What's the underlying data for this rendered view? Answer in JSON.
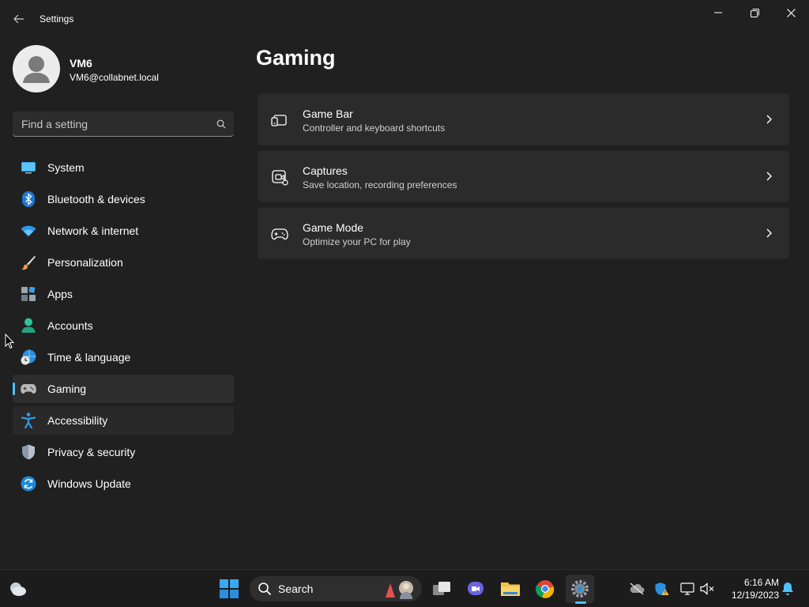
{
  "window": {
    "title": "Settings"
  },
  "profile": {
    "name": "VM6",
    "email": "VM6@collabnet.local"
  },
  "search": {
    "placeholder": "Find a setting"
  },
  "sidebar": {
    "items": [
      {
        "label": "System",
        "icon": "system-icon"
      },
      {
        "label": "Bluetooth & devices",
        "icon": "bluetooth-icon"
      },
      {
        "label": "Network & internet",
        "icon": "wifi-icon"
      },
      {
        "label": "Personalization",
        "icon": "brush-icon"
      },
      {
        "label": "Apps",
        "icon": "apps-icon"
      },
      {
        "label": "Accounts",
        "icon": "person-icon"
      },
      {
        "label": "Time & language",
        "icon": "globe-clock-icon"
      },
      {
        "label": "Gaming",
        "icon": "gamepad-icon",
        "selected": true
      },
      {
        "label": "Accessibility",
        "icon": "accessibility-icon"
      },
      {
        "label": "Privacy & security",
        "icon": "shield-icon"
      },
      {
        "label": "Windows Update",
        "icon": "update-icon"
      }
    ]
  },
  "main": {
    "title": "Gaming",
    "cards": [
      {
        "title": "Game Bar",
        "subtitle": "Controller and keyboard shortcuts",
        "icon": "game-bar-icon"
      },
      {
        "title": "Captures",
        "subtitle": "Save location, recording preferences",
        "icon": "captures-icon"
      },
      {
        "title": "Game Mode",
        "subtitle": "Optimize your PC for play",
        "icon": "controller-icon"
      }
    ]
  },
  "taskbar": {
    "search_label": "Search",
    "time": "6:16 AM",
    "date": "12/19/2023"
  },
  "colors": {
    "accent": "#4cc2ff",
    "background": "#202020",
    "card": "#2b2b2b"
  }
}
